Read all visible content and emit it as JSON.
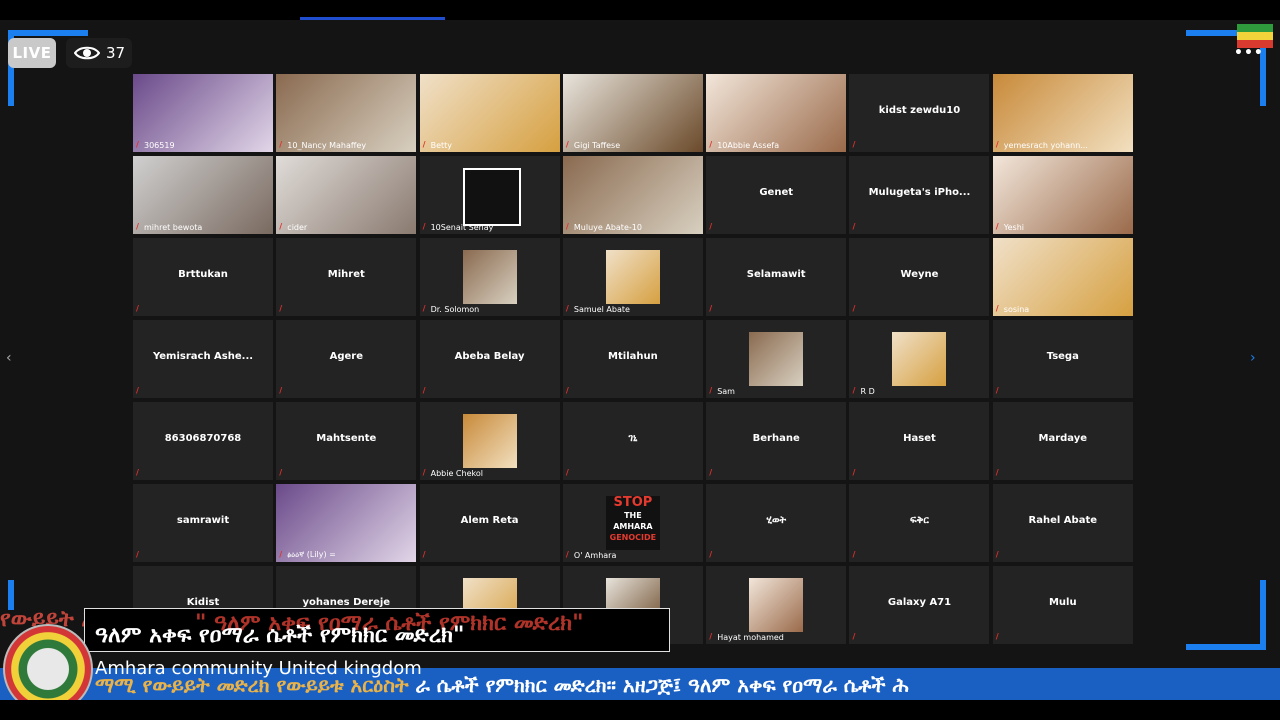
{
  "overlay": {
    "live_label": "LIVE",
    "viewer_count": "37"
  },
  "tiles": [
    {
      "label": "306519",
      "type": "video"
    },
    {
      "label": "10_Nancy Mahaffey",
      "type": "video"
    },
    {
      "label": "Betty",
      "type": "video"
    },
    {
      "label": "Gigi Taffese",
      "type": "video"
    },
    {
      "label": "10Abbie Assefa",
      "type": "video",
      "active": true
    },
    {
      "name": "kidst zewdu10",
      "type": "name"
    },
    {
      "label": "yemesrach yohann...",
      "type": "video"
    },
    {
      "label": "mihret bewota",
      "type": "video"
    },
    {
      "label": "cider",
      "type": "video"
    },
    {
      "label": "10Senait Senay",
      "type": "logo"
    },
    {
      "label": "Muluye Abate-10",
      "type": "video"
    },
    {
      "name": "Genet",
      "type": "name"
    },
    {
      "name": "Mulugeta's iPho...",
      "type": "name"
    },
    {
      "label": "Yeshi",
      "type": "video"
    },
    {
      "name": "Brttukan",
      "type": "name"
    },
    {
      "name": "Mihret",
      "type": "name"
    },
    {
      "label": "Dr. Solomon",
      "type": "thumb"
    },
    {
      "label": "Samuel Abate",
      "type": "thumb"
    },
    {
      "name": "Selamawit",
      "type": "name"
    },
    {
      "name": "Weyne",
      "type": "name"
    },
    {
      "label": "sosina",
      "type": "video"
    },
    {
      "name": "Yemisrach Ashe...",
      "type": "name"
    },
    {
      "name": "Agere",
      "type": "name"
    },
    {
      "name": "Abeba Belay",
      "type": "name"
    },
    {
      "name": "Mtilahun",
      "type": "name"
    },
    {
      "label": "Sam",
      "type": "thumb"
    },
    {
      "label": "R D",
      "type": "thumb"
    },
    {
      "name": "Tsega",
      "type": "name"
    },
    {
      "name": "86306870768",
      "type": "name"
    },
    {
      "name": "Mahtsente",
      "type": "name"
    },
    {
      "label": "Abbie Chekol",
      "type": "thumb"
    },
    {
      "name": "ገኒ",
      "type": "name"
    },
    {
      "name": "Berhane",
      "type": "name"
    },
    {
      "name": "Haset",
      "type": "name"
    },
    {
      "name": "Mardaye",
      "type": "name"
    },
    {
      "name": "samrawit",
      "type": "name"
    },
    {
      "label": "ፅዕዕኛ (Lily) =",
      "type": "video"
    },
    {
      "name": "Alem Reta",
      "type": "name"
    },
    {
      "label": "O' Amhara",
      "type": "stop"
    },
    {
      "name": "ሂወት",
      "type": "name"
    },
    {
      "name": "ፍቅር",
      "type": "name"
    },
    {
      "name": "Rahel Abate",
      "type": "name"
    },
    {
      "name": "Kidist",
      "type": "name"
    },
    {
      "name": "yohanes Dereje",
      "type": "name"
    },
    {
      "label": "",
      "type": "thumb"
    },
    {
      "label": "",
      "type": "thumb"
    },
    {
      "label": "Hayat mohamed",
      "type": "thumb"
    },
    {
      "name": "Galaxy A71",
      "type": "name"
    },
    {
      "name": "Mulu",
      "type": "name"
    }
  ],
  "stop_sign": {
    "line1": "STOP",
    "line2": "THE",
    "line3": "AMHARA",
    "line4": "GENOCIDE"
  },
  "banner": {
    "title": "ዓለም አቀፍ የዐማራ ሴቶች የምክክር መድረክ\"",
    "overlay_title": "\" ዓለም አቀፍ የዐማራ ሴቶች የምክክር መድረክ\"",
    "subtitle": "Amhara community United kingdom",
    "ticker_left": "የውይይት አርዕስት",
    "ticker_bottom_left": "ማሚ የውይይት መድረክ የውይይቱ አርዕስት",
    "ticker_bottom_right": "ራ ሴቶች የምክክር መድረክ፡፡   አዘጋጅ፤ ዓለም አቀፍ የዐማራ ሴቶች ሕ"
  },
  "colors": {
    "accent": "#1b7ff0",
    "active_speaker": "#b8e35a",
    "muted": "#e0312c"
  }
}
